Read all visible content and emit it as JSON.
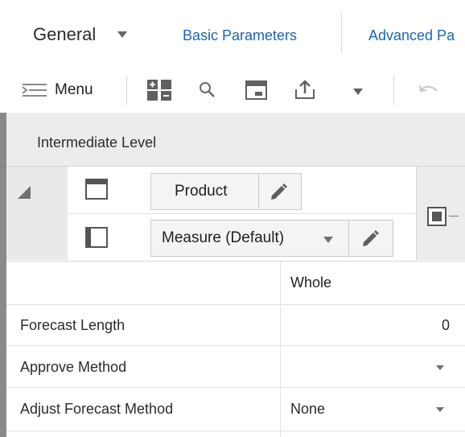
{
  "nav": {
    "page_selector": "General",
    "tabs": [
      "Basic Parameters",
      "Advanced Pa"
    ]
  },
  "toolbar": {
    "menu_label": "Menu",
    "icons": [
      "hamburger-menu-icon",
      "columns-layout-icon",
      "search-icon",
      "calendar-icon",
      "export-icon",
      "dropdown-caret-icon",
      "undo-icon"
    ]
  },
  "level": {
    "label": "Intermediate Level"
  },
  "pivot": {
    "row_tile": "Product",
    "column_tile": "Measure (Default)"
  },
  "grid": {
    "column_header": "Whole",
    "rows": [
      {
        "label": "Forecast Length",
        "value": "0",
        "has_dropdown": false
      },
      {
        "label": "Approve Method",
        "value": "",
        "has_dropdown": true
      },
      {
        "label": "Adjust Forecast Method",
        "value": "None",
        "has_dropdown": true
      }
    ]
  },
  "colors": {
    "link": "#1a66b0",
    "header_bg": "#ececec",
    "border_dark": "#8a8a8a"
  }
}
